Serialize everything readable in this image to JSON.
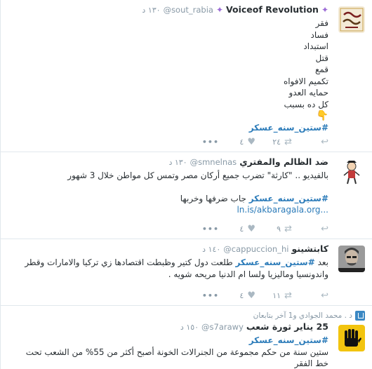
{
  "colors": {
    "accent": "#2b7bb9",
    "muted": "#8899a6",
    "border": "#e1e8ed"
  },
  "tweets": [
    {
      "fullname": "Voiceof Revolution",
      "username": "@sout_rabia",
      "time": "١٣٠ د",
      "lines": [
        "فقر",
        "فساد",
        "استبداد",
        "قتل",
        "قمع",
        "تكميم الافواه",
        "حمايه العدو",
        "كل ده بسبب"
      ],
      "emoji": "👇",
      "hashtag": "#ستين_سنه_عسكر",
      "retweets": "٢٤",
      "favorites": "٤",
      "more": "•••"
    },
    {
      "fullname": "ضد الظالم والمفتري",
      "username": "@smnelnas",
      "time": "١٣٠ د",
      "lines": [
        "بالفيديو .. \"كارثة\" تضرب جميع أركان مصر وتمس كل مواطن خلال 3 شهور"
      ],
      "hashtag": "#ستين_سنه_عسكر",
      "after_hashtag": " جاب ضرفها وخربها",
      "link": "ln.is/akbaragala.org...",
      "retweets": "٩",
      "favorites": "٤",
      "more": "•••"
    },
    {
      "fullname": "كابتشينو",
      "username": "@cappuccion_hi",
      "time": "١٤٠ د",
      "prefix": "بعد ",
      "hashtag": "#ستين_سنه_عسكر",
      "after_hashtag": " طلعت دول كتير وظبطت اقتصادها زي تركيا والامارات وقطر",
      "lines": [
        "واندونسيا وماليزيا ولسا ام الدنيا مريحه شويه ."
      ],
      "retweets": "١١",
      "favorites": "٤",
      "more": "•••"
    },
    {
      "context": "د . محمد الجوادي و1 آخر بتابعان",
      "fullname": "25 يناير ثورة شعب",
      "username": "@s7arawy",
      "time": "١٥٠ د",
      "hashtag": "#ستين_سنه_عسكر",
      "lines": [
        "ستين سنة من حكم مجموعة من الجنرالات الخونة أصبح أكثر من 55% من الشعب تحت",
        "خط الفقر"
      ]
    }
  ]
}
